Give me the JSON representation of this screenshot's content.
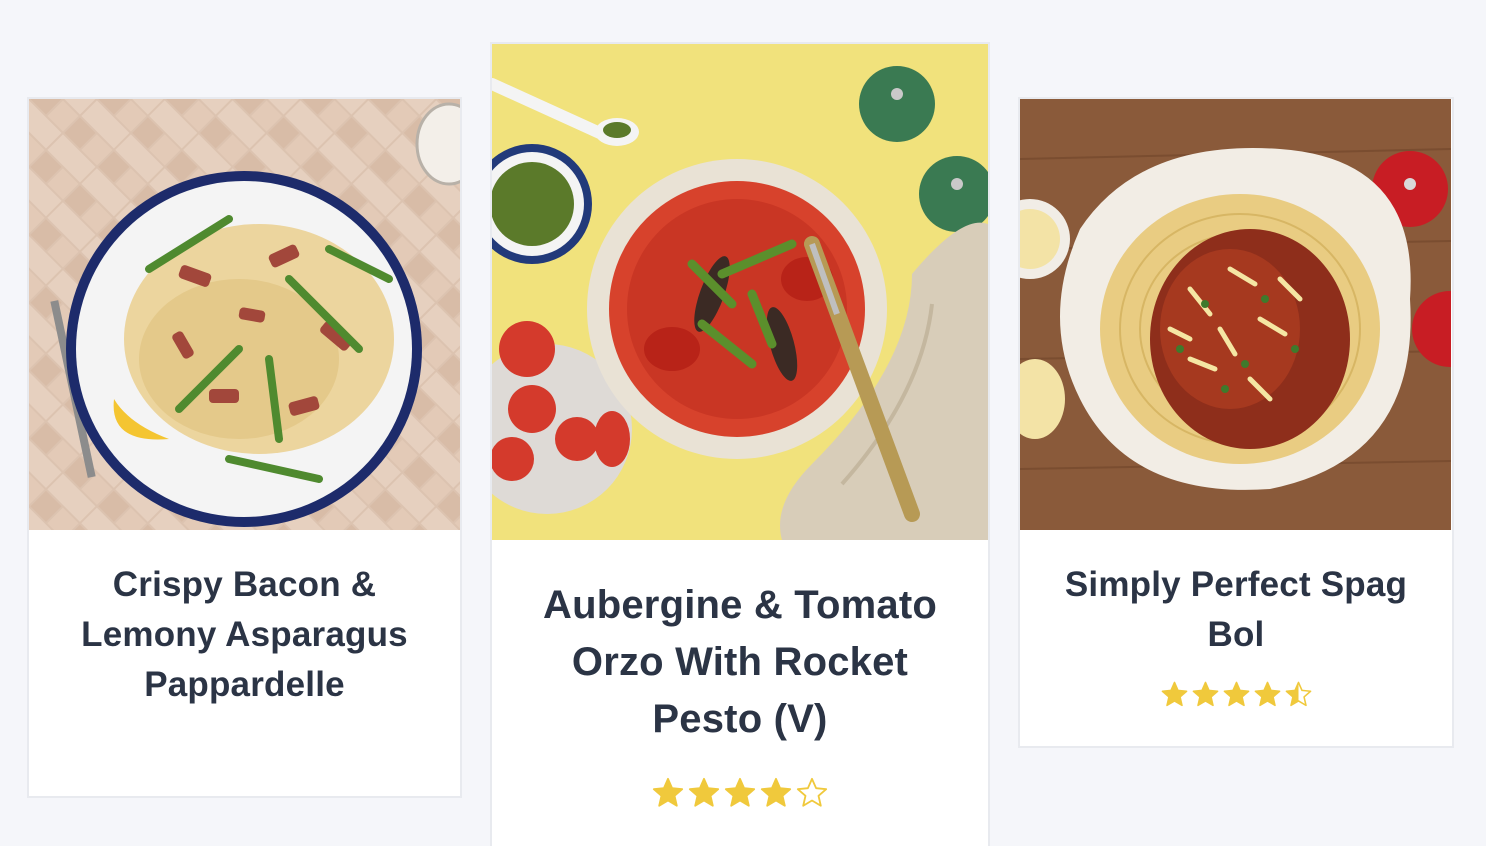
{
  "recipes": [
    {
      "title": "Crispy Bacon & Lemony Asparagus Pappardelle",
      "image_alt": "Pappardelle with bacon and asparagus on a blue-rimmed plate",
      "rating": null
    },
    {
      "title": "Aubergine & Tomato Orzo With Rocket Pesto (V)",
      "image_alt": "Orzo with aubergine, tomato and rocket on a yellow table",
      "rating": 4
    },
    {
      "title": "Simply Perfect Spag Bol",
      "image_alt": "Spaghetti bolognese with grated cheese",
      "rating": 4.5
    }
  ],
  "rating_scale": 5,
  "colors": {
    "star_fill": "#f0c93c",
    "title_text": "#2b3445",
    "page_bg": "#f5f6fa",
    "card_border": "#e8eaef"
  }
}
